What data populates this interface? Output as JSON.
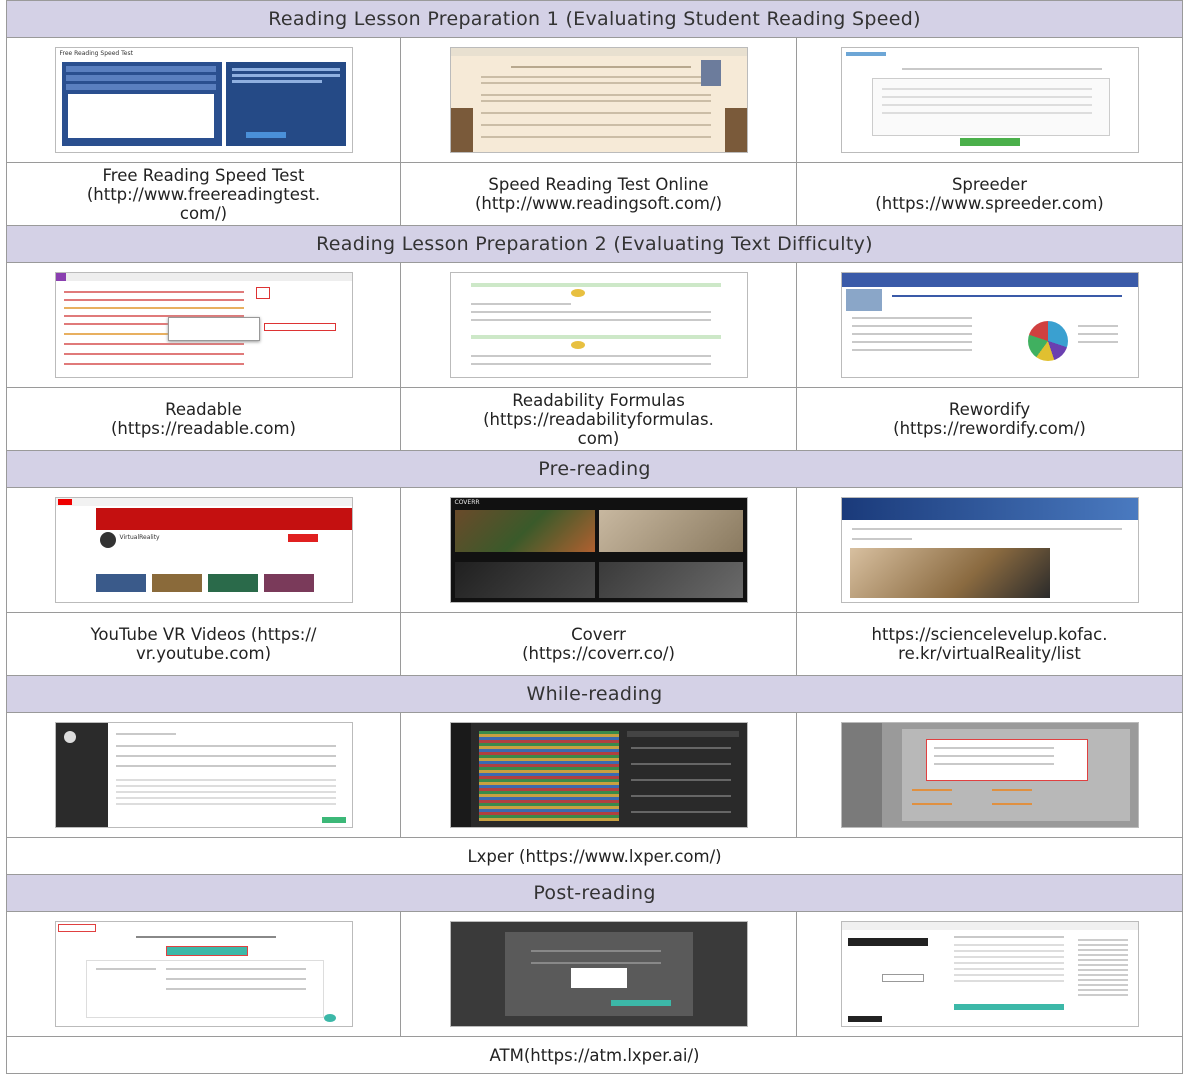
{
  "sections": [
    {
      "heading": "Reading Lesson Preparation 1 (Evaluating Student Reading Speed)",
      "items": [
        {
          "caption": [
            "Free Reading Speed Test",
            "(http://www.freereadingtest.",
            "com/)"
          ],
          "thumb_text": "Free Reading Speed Test"
        },
        {
          "caption": [
            "Speed Reading Test Online",
            "(http://www.readingsoft.com/)"
          ]
        },
        {
          "caption": [
            "Spreeder",
            "(https://www.spreeder.com)"
          ]
        }
      ]
    },
    {
      "heading": "Reading Lesson Preparation 2 (Evaluating Text Difficulty)",
      "items": [
        {
          "caption": [
            "Readable",
            "(https://readable.com)"
          ]
        },
        {
          "caption": [
            "Readability Formulas",
            "(https://readabilityformulas.",
            "com)"
          ]
        },
        {
          "caption": [
            "Rewordify",
            "(https://rewordify.com/)"
          ]
        }
      ]
    },
    {
      "heading": "Pre-reading",
      "items": [
        {
          "caption": [
            "YouTube VR Videos (https://",
            "vr.youtube.com)"
          ],
          "thumb_text": "VirtualReality"
        },
        {
          "caption": [
            "Coverr",
            "(https://coverr.co/)"
          ],
          "thumb_text": "COVERR"
        },
        {
          "caption": [
            "https://sciencelevelup.kofac.",
            "re.kr/virtualReality/list"
          ]
        }
      ]
    },
    {
      "heading": "While-reading",
      "caption": "Lxper (https://www.lxper.com/)"
    },
    {
      "heading": "Post-reading",
      "caption": "ATM(https://atm.lxper.ai/)"
    }
  ]
}
